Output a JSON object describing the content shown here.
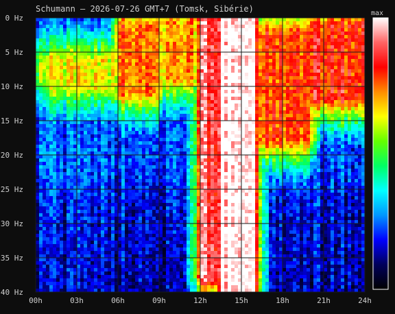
{
  "chart_data": {
    "type": "heatmap",
    "title": "Schumann – 2026-07-26 GMT+7  (Tomsk, Sibérie)",
    "x_ticks": [
      "00h",
      "03h",
      "06h",
      "09h",
      "12h",
      "15h",
      "18h",
      "21h",
      "24h"
    ],
    "y_ticks": [
      "0 Hz",
      "5 Hz",
      "10 Hz",
      "15 Hz",
      "20 Hz",
      "25 Hz",
      "30 Hz",
      "35 Hz",
      "40 Hz"
    ],
    "x_range_hours": [
      0,
      24
    ],
    "y_range_hz": [
      0,
      40
    ],
    "colorbar_label": "max",
    "colorscale": [
      "#000000",
      "#00005a",
      "#0000ff",
      "#0096ff",
      "#00ffff",
      "#00ff64",
      "#64ff00",
      "#ffff00",
      "#ff8c00",
      "#ff0000",
      "#ff6464",
      "#ffffff"
    ],
    "grid": true,
    "intensity_bands": [
      {
        "hours": [
          0,
          2
        ],
        "hz": [
          6,
          9
        ],
        "level": 0.55
      },
      {
        "hours": [
          1,
          6
        ],
        "hz": [
          6,
          10
        ],
        "level": 0.62
      },
      {
        "hours": [
          6,
          9
        ],
        "hz": [
          1,
          11
        ],
        "level": 0.75
      },
      {
        "hours": [
          9,
          12
        ],
        "hz": [
          0,
          9
        ],
        "level": 0.7
      },
      {
        "hours": [
          12,
          13.5
        ],
        "hz": [
          0,
          38
        ],
        "level": 0.9
      },
      {
        "hours": [
          13.5,
          16
        ],
        "hz": [
          0,
          40
        ],
        "level": 1.0
      },
      {
        "hours": [
          16,
          20
        ],
        "hz": [
          2,
          18
        ],
        "level": 0.78
      },
      {
        "hours": [
          20,
          24
        ],
        "hz": [
          1,
          12
        ],
        "level": 0.82
      }
    ]
  }
}
